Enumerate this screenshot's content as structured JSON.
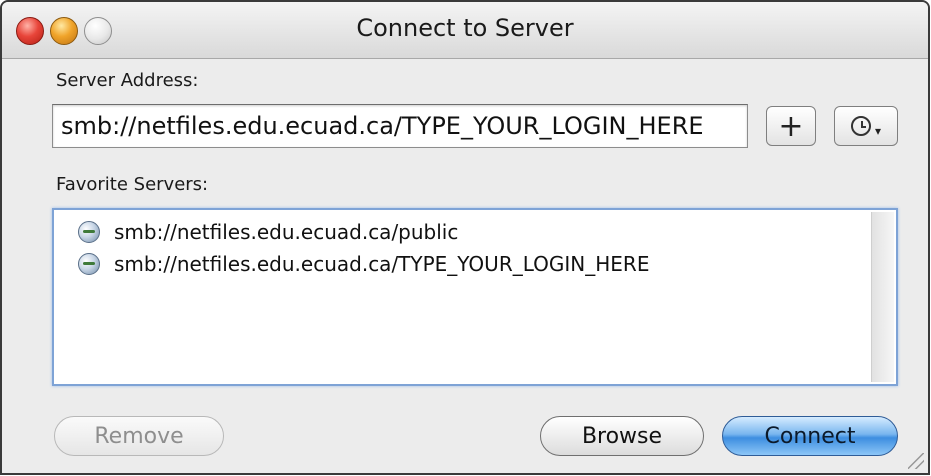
{
  "window": {
    "title": "Connect to Server"
  },
  "server": {
    "label": "Server Address:",
    "address_value": "smb://netfiles.edu.ecuad.ca/TYPE_YOUR_LOGIN_HERE",
    "add_label": "+"
  },
  "favorites": {
    "label": "Favorite Servers:",
    "items": [
      {
        "label": "smb://netfiles.edu.ecuad.ca/public",
        "icon": "server-globe-icon"
      },
      {
        "label": "smb://netfiles.edu.ecuad.ca/TYPE_YOUR_LOGIN_HERE",
        "icon": "server-globe-icon"
      }
    ]
  },
  "buttons": {
    "remove": "Remove",
    "browse": "Browse",
    "connect": "Connect"
  },
  "colors": {
    "connect_accent": "#3d8ee0",
    "focus_ring": "#7ea3d6"
  }
}
